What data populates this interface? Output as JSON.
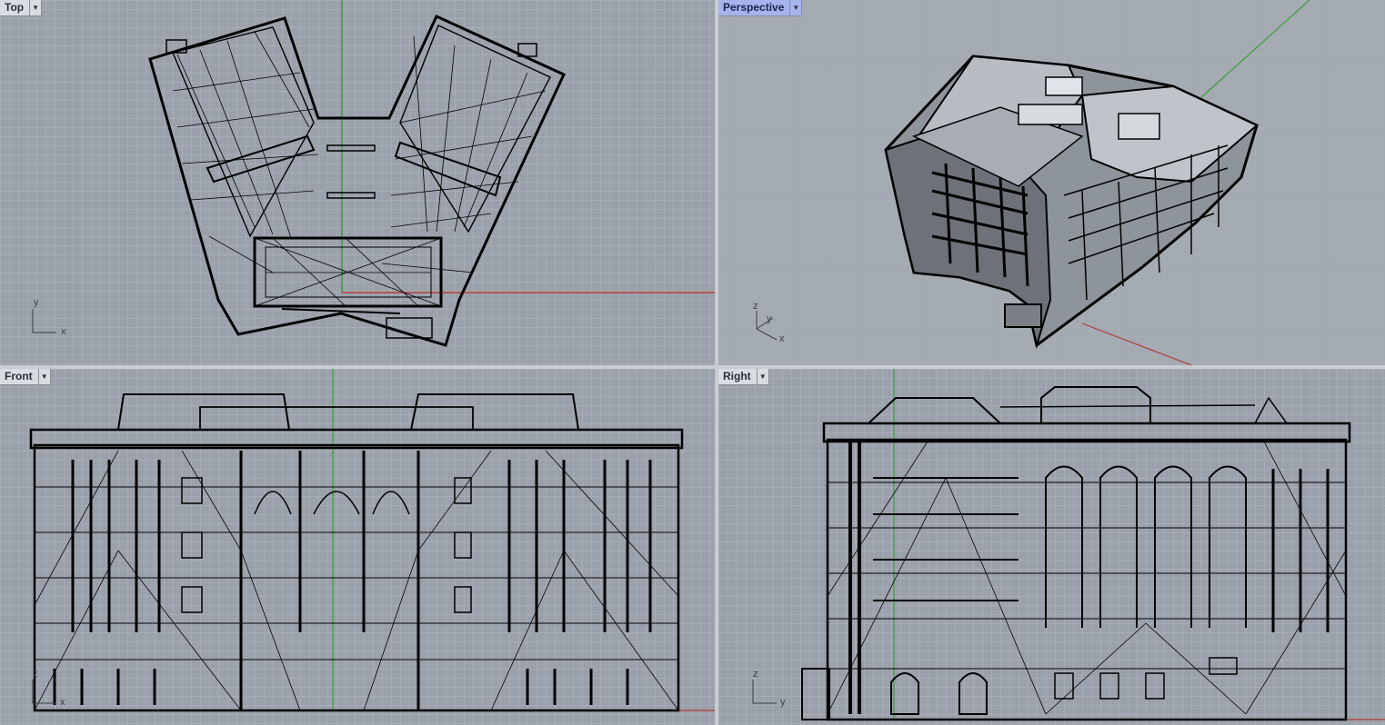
{
  "viewports": {
    "top": {
      "title": "Top",
      "axes": [
        "y",
        "x"
      ]
    },
    "perspective": {
      "title": "Perspective",
      "axes": [
        "z",
        "y",
        "x"
      ]
    },
    "front": {
      "title": "Front",
      "axes": [
        "z",
        "x"
      ]
    },
    "right": {
      "title": "Right",
      "axes": [
        "z",
        "y"
      ]
    }
  },
  "icons": {
    "viewport_menu": "chevron-down-icon"
  },
  "colors": {
    "viewport_bg": "#9aa1ab",
    "grid": "#a6adb6",
    "x_axis": "#b53a3a",
    "y_axis": "#3aa03a",
    "active_tab": "#a7b3ec",
    "mesh": "#000000"
  }
}
